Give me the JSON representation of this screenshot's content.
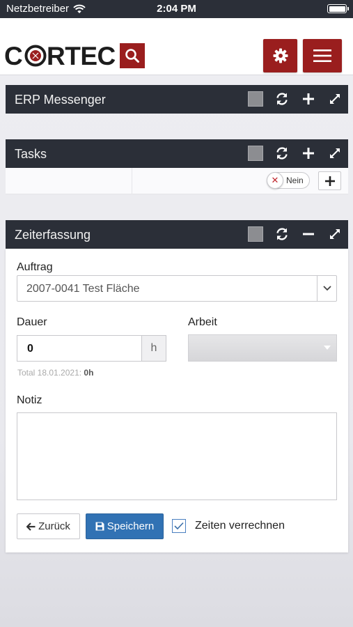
{
  "status_bar": {
    "carrier": "Netzbetreiber",
    "time": "2:04 PM"
  },
  "header": {
    "logo_text": "CORTEC",
    "brand_color": "#9a1e1e"
  },
  "widgets": {
    "erp": {
      "title": "ERP Messenger"
    },
    "tasks": {
      "title": "Tasks",
      "toggle_label": "Nein"
    },
    "zeit": {
      "title": "Zeiterfassung"
    }
  },
  "form": {
    "auftrag_label": "Auftrag",
    "auftrag_value": "2007-0041 Test Fläche",
    "dauer_label": "Dauer",
    "dauer_value": "0",
    "dauer_unit": "h",
    "arbeit_label": "Arbeit",
    "total_prefix": "Total 18.01.2021:",
    "total_value": "0h",
    "notiz_label": "Notiz",
    "back_label": "Zurück",
    "save_label": "Speichern",
    "verrechnen_label": "Zeiten verrechnen",
    "verrechnen_checked": true
  },
  "colors": {
    "panel_header": "#2b2f38",
    "primary": "#3172b4"
  },
  "icons": [
    "wifi-icon",
    "battery-icon",
    "search-icon",
    "gear-icon",
    "menu-icon",
    "refresh-icon",
    "plus-icon",
    "minus-icon",
    "expand-icon",
    "close-icon",
    "chevron-down-icon",
    "arrow-left-icon",
    "save-icon",
    "checkmark-icon"
  ]
}
